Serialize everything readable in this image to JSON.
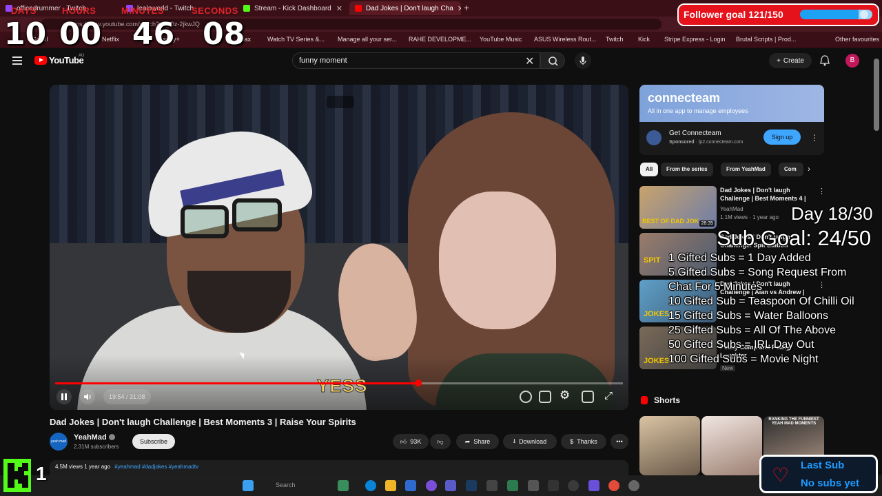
{
  "browser": {
    "tabs": [
      {
        "title": "officedrummer - Twitch",
        "favicon_color": "#9146ff"
      },
      {
        "title": "lealoworld - Twitch",
        "favicon_color": "#9146ff"
      },
      {
        "title": "Stream - Kick Dashboard",
        "favicon_color": "#53fc18"
      },
      {
        "title": "Dad Jokes | Don't laugh Cha",
        "favicon_color": "#ff0000"
      }
    ],
    "new_tab": "+",
    "url": "https://www.youtube.com/watch?v=_Oz-2jkwJQ",
    "bookmarks": [
      "Gmail",
      "Netflix",
      "Stan",
      "Disney+",
      "Max",
      "Watch TV Series &...",
      "Manage all your ser...",
      "RAHE DEVELOPME...",
      "YouTube Music",
      "ASUS Wireless Rout...",
      "Twitch",
      "Kick",
      "Stripe Express - Login",
      "Brutal Scripts | Prod..."
    ],
    "other_favourites": "Other favourites"
  },
  "youtube": {
    "logo_text": "YouTube",
    "region": "AU",
    "search_value": "funny moment",
    "create_label": "Create",
    "avatar_letter": "B",
    "brand_color": "#ff0000"
  },
  "player": {
    "current_time": "19:54",
    "duration": "31:08",
    "time_display": "19:54 / 31:08",
    "progress_fraction": 0.639,
    "caption_overlay": "YESS"
  },
  "video": {
    "title": "Dad Jokes | Don't laugh Challenge | Best Moments 3 | Raise Your Spirits",
    "channel": "YeahMad",
    "channel_avatar_text": "yeah mad",
    "subscribers": "2.31M subscribers",
    "subscribe_label": "Subscribe",
    "likes": "93K",
    "share_label": "Share",
    "download_label": "Download",
    "thanks_label": "Thanks",
    "views": "4.5M views",
    "age": "1 year ago",
    "tags": "#yeahmad #dadjokes #yeahmadtv"
  },
  "ad": {
    "brand": "connecteam",
    "tagline": "All in one app to manage employees",
    "name": "Get Connecteam",
    "sponsor": "Sponsored",
    "domain": "lp2.connecteam.com",
    "signup_label": "Sign up"
  },
  "chips": [
    "All",
    "From the series",
    "From YeahMad",
    "Com"
  ],
  "related": [
    {
      "title": "Dad Jokes | Don't laugh Challenge | Best Moments 4 |",
      "channel": "YeahMad",
      "meta": "1.1M views · 1 year ago",
      "duration": "28:35",
      "thumb_text": "BEST OF DAD JOK"
    },
    {
      "title": "Dad Jokes | Don't laugh Challenge: Spit Edition",
      "channel": "",
      "meta": "",
      "duration": "",
      "thumb_text": "SPIT"
    },
    {
      "title": "Dad Jokes | Don't laugh Challenge | Alan vs Andrew |",
      "channel": "",
      "meta": "",
      "duration": "",
      "thumb_text": "JOKES"
    },
    {
      "title": "Peaky Comp and Peaky Laughter",
      "channel": "",
      "meta": "New",
      "duration": "",
      "thumb_text": "JOKES"
    }
  ],
  "shorts": {
    "label": "Shorts",
    "items": [
      {
        "caption": ""
      },
      {
        "caption": ""
      },
      {
        "caption": "RANKING THE FUNNIEST YEAH MAD MOMENTS"
      }
    ]
  },
  "taskbar": {
    "search_placeholder": "Search"
  },
  "overlay": {
    "timer": {
      "labels": [
        "DAYS",
        "HOURS",
        "MINUTES",
        "SECONDS"
      ],
      "values": [
        "10",
        "00",
        "46",
        "08"
      ]
    },
    "follower_goal": {
      "text": "Follower goal 121/150",
      "current": 121,
      "target": 150
    },
    "day_counter": "Day 18/30",
    "sub_goal": "Sub Goal: 24/50",
    "rewards": [
      "1 Gifted Subs = 1 Day Added",
      "5 Gifted Subs =  Song Request From",
      "Chat For 5 Minutes",
      "10 Gifted Sub = Teaspoon Of Chilli Oil",
      "15 Gifted Subs = Water Balloons",
      "25 Gifted Subs = All Of The Above",
      "50 Gifted Subs = IRL Day Out",
      "100 Gifted Subs = Movie Night"
    ],
    "kick_viewers": "1",
    "last_sub_title": "Last Sub",
    "last_sub_value": "No subs yet",
    "accent_red": "#e5111b",
    "accent_blue": "#1e9bff",
    "kick_green": "#53fc18"
  }
}
